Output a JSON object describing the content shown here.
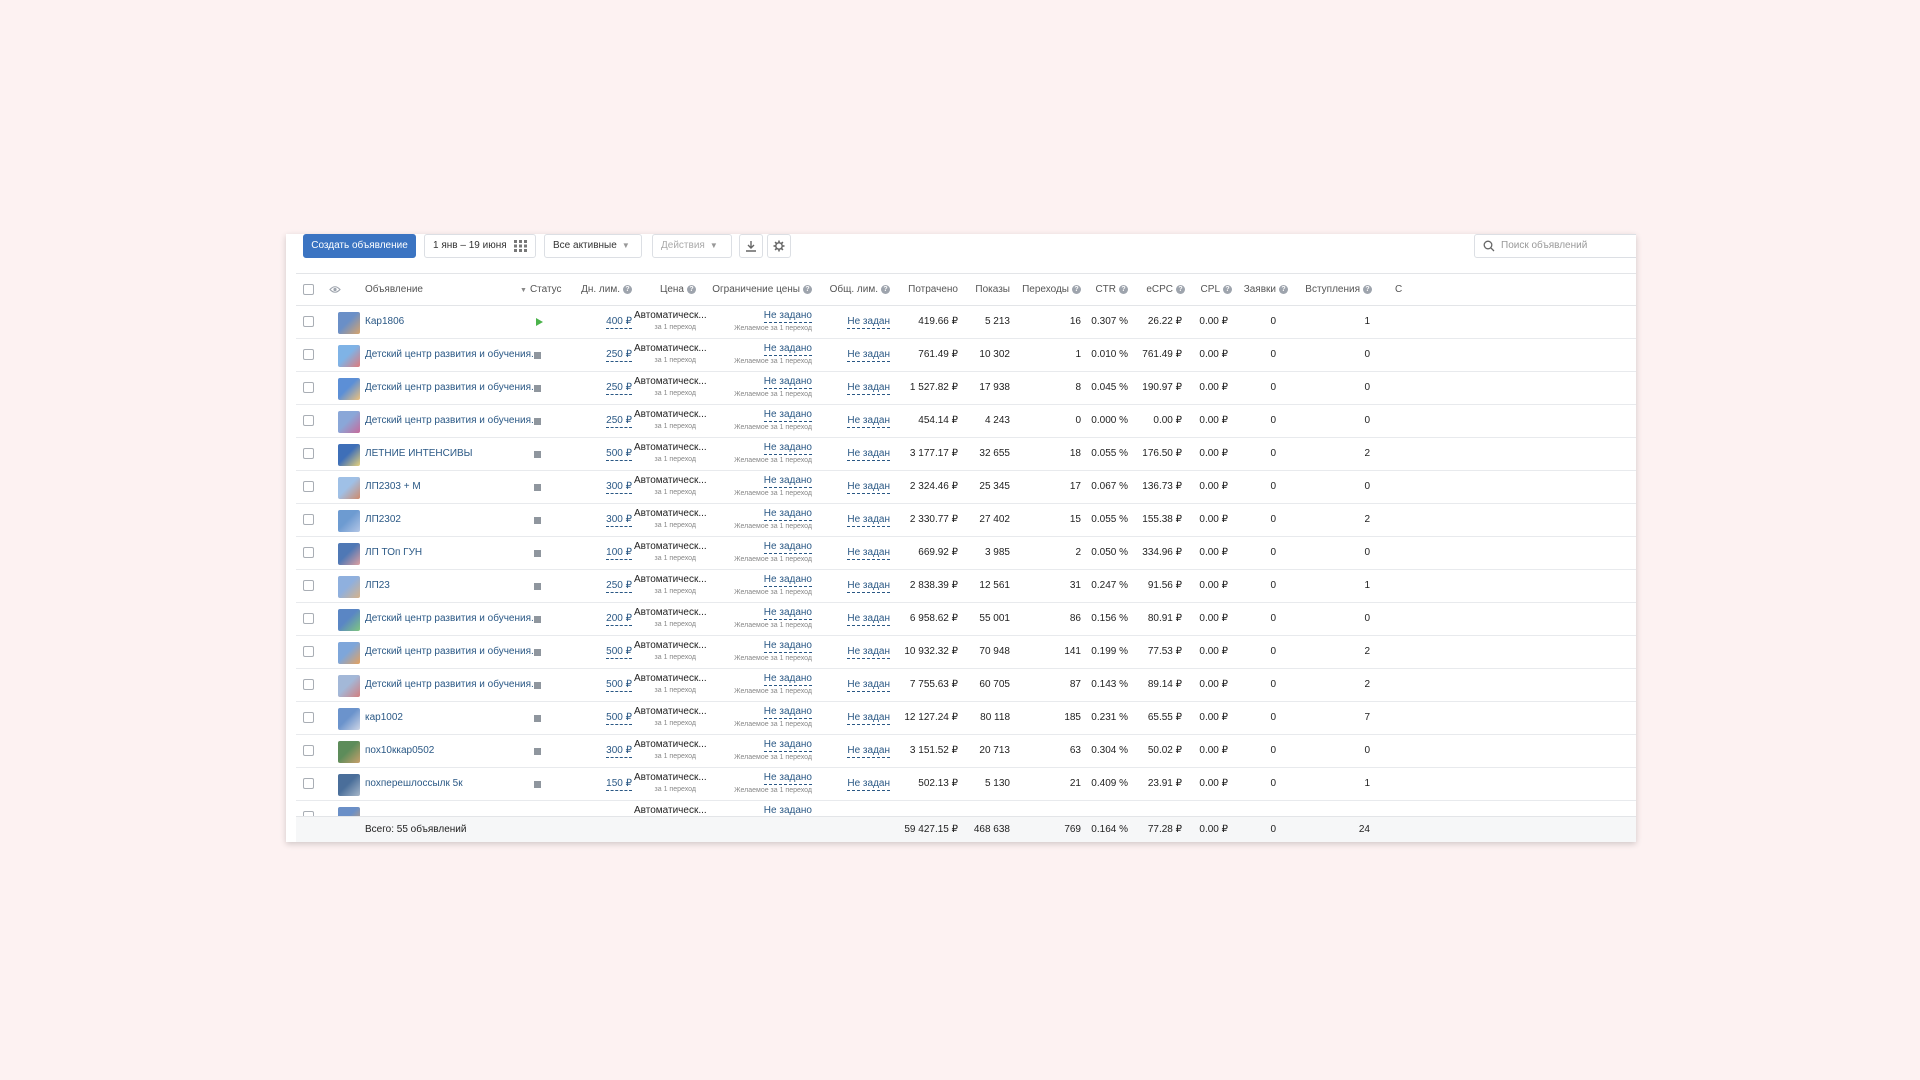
{
  "toolbar": {
    "create_label": "Создать объявление",
    "date_range": "1 янв – 19 июня",
    "filter_label": "Все активные",
    "actions_label": "Действия",
    "search_placeholder": "Поиск объявлений"
  },
  "columns": {
    "ad": "Объявление",
    "status": "Статус",
    "daily_limit": "Дн. лим.",
    "price": "Цена",
    "price_limit": "Ограничение цены",
    "total_limit": "Общ. лим.",
    "spent": "Потрачено",
    "impressions": "Показы",
    "clicks": "Переходы",
    "ctr": "CTR",
    "ecpc": "eCPC",
    "cpl": "CPL",
    "requests": "Заявки",
    "joins": "Вступления",
    "next": "С"
  },
  "row_common": {
    "price_main": "Автоматическ...",
    "price_sub": "за 1 переход",
    "limit_main": "Не задано",
    "limit_sub": "Желаемое за 1 переход",
    "total_limit": "Не задан"
  },
  "rows": [
    {
      "name": "Кар1806",
      "status": "running",
      "daily": "400 ₽",
      "spent": "419.66 ₽",
      "impressions": "5 213",
      "clicks": "16",
      "ctr": "0.307 %",
      "ecpc": "26.22 ₽",
      "cpl": "0.00 ₽",
      "requests": "0",
      "joins": "1"
    },
    {
      "name": "Детский центр развития и обучения...",
      "status": "stopped",
      "daily": "250 ₽",
      "spent": "761.49 ₽",
      "impressions": "10 302",
      "clicks": "1",
      "ctr": "0.010 %",
      "ecpc": "761.49 ₽",
      "cpl": "0.00 ₽",
      "requests": "0",
      "joins": "0"
    },
    {
      "name": "Детский центр развития и обучения...",
      "status": "stopped",
      "daily": "250 ₽",
      "spent": "1 527.82 ₽",
      "impressions": "17 938",
      "clicks": "8",
      "ctr": "0.045 %",
      "ecpc": "190.97 ₽",
      "cpl": "0.00 ₽",
      "requests": "0",
      "joins": "0"
    },
    {
      "name": "Детский центр развития и обучения...",
      "status": "stopped",
      "daily": "250 ₽",
      "spent": "454.14 ₽",
      "impressions": "4 243",
      "clicks": "0",
      "ctr": "0.000 %",
      "ecpc": "0.00 ₽",
      "cpl": "0.00 ₽",
      "requests": "0",
      "joins": "0"
    },
    {
      "name": "ЛЕТНИЕ ИНТЕНСИВЫ",
      "status": "stopped",
      "daily": "500 ₽",
      "spent": "3 177.17 ₽",
      "impressions": "32 655",
      "clicks": "18",
      "ctr": "0.055 %",
      "ecpc": "176.50 ₽",
      "cpl": "0.00 ₽",
      "requests": "0",
      "joins": "2"
    },
    {
      "name": "ЛП2303 + М",
      "status": "stopped",
      "daily": "300 ₽",
      "spent": "2 324.46 ₽",
      "impressions": "25 345",
      "clicks": "17",
      "ctr": "0.067 %",
      "ecpc": "136.73 ₽",
      "cpl": "0.00 ₽",
      "requests": "0",
      "joins": "0"
    },
    {
      "name": "ЛП2302",
      "status": "stopped",
      "daily": "300 ₽",
      "spent": "2 330.77 ₽",
      "impressions": "27 402",
      "clicks": "15",
      "ctr": "0.055 %",
      "ecpc": "155.38 ₽",
      "cpl": "0.00 ₽",
      "requests": "0",
      "joins": "2"
    },
    {
      "name": "ЛП ТОп ГУН",
      "status": "stopped",
      "daily": "100 ₽",
      "spent": "669.92 ₽",
      "impressions": "3 985",
      "clicks": "2",
      "ctr": "0.050 %",
      "ecpc": "334.96 ₽",
      "cpl": "0.00 ₽",
      "requests": "0",
      "joins": "0"
    },
    {
      "name": "ЛП23",
      "status": "stopped",
      "daily": "250 ₽",
      "spent": "2 838.39 ₽",
      "impressions": "12 561",
      "clicks": "31",
      "ctr": "0.247 %",
      "ecpc": "91.56 ₽",
      "cpl": "0.00 ₽",
      "requests": "0",
      "joins": "1"
    },
    {
      "name": "Детский центр развития и обучения...",
      "status": "stopped",
      "daily": "200 ₽",
      "spent": "6 958.62 ₽",
      "impressions": "55 001",
      "clicks": "86",
      "ctr": "0.156 %",
      "ecpc": "80.91 ₽",
      "cpl": "0.00 ₽",
      "requests": "0",
      "joins": "0"
    },
    {
      "name": "Детский центр развития и обучения...",
      "status": "stopped",
      "daily": "500 ₽",
      "spent": "10 932.32 ₽",
      "impressions": "70 948",
      "clicks": "141",
      "ctr": "0.199 %",
      "ecpc": "77.53 ₽",
      "cpl": "0.00 ₽",
      "requests": "0",
      "joins": "2"
    },
    {
      "name": "Детский центр развития и обучения...",
      "status": "stopped",
      "daily": "500 ₽",
      "spent": "7 755.63 ₽",
      "impressions": "60 705",
      "clicks": "87",
      "ctr": "0.143 %",
      "ecpc": "89.14 ₽",
      "cpl": "0.00 ₽",
      "requests": "0",
      "joins": "2"
    },
    {
      "name": "кар1002",
      "status": "stopped",
      "daily": "500 ₽",
      "spent": "12 127.24 ₽",
      "impressions": "80 118",
      "clicks": "185",
      "ctr": "0.231 %",
      "ecpc": "65.55 ₽",
      "cpl": "0.00 ₽",
      "requests": "0",
      "joins": "7"
    },
    {
      "name": "пох10ккар0502",
      "status": "stopped",
      "daily": "300 ₽",
      "spent": "3 151.52 ₽",
      "impressions": "20 713",
      "clicks": "63",
      "ctr": "0.304 %",
      "ecpc": "50.02 ₽",
      "cpl": "0.00 ₽",
      "requests": "0",
      "joins": "0"
    },
    {
      "name": "похперешлоссылк 5к",
      "status": "stopped",
      "daily": "150 ₽",
      "spent": "502.13 ₽",
      "impressions": "5 130",
      "clicks": "21",
      "ctr": "0.409 %",
      "ecpc": "23.91 ₽",
      "cpl": "0.00 ₽",
      "requests": "0",
      "joins": "1"
    }
  ],
  "partial_row": {
    "price_main": "Автоматическ...",
    "limit_main": "Не задано"
  },
  "footer": {
    "total_label": "Всего: 55 объявлений",
    "spent": "59 427.15 ₽",
    "impressions": "468 638",
    "clicks": "769",
    "ctr": "0.164 %",
    "ecpc": "77.28 ₽",
    "cpl": "0.00 ₽",
    "requests": "0",
    "joins": "24"
  },
  "colors": {
    "primary": "#3b74c2",
    "link": "#2a5885",
    "running": "#4bb34b",
    "stopped": "#8f969e",
    "background": "#fdf2f2"
  }
}
